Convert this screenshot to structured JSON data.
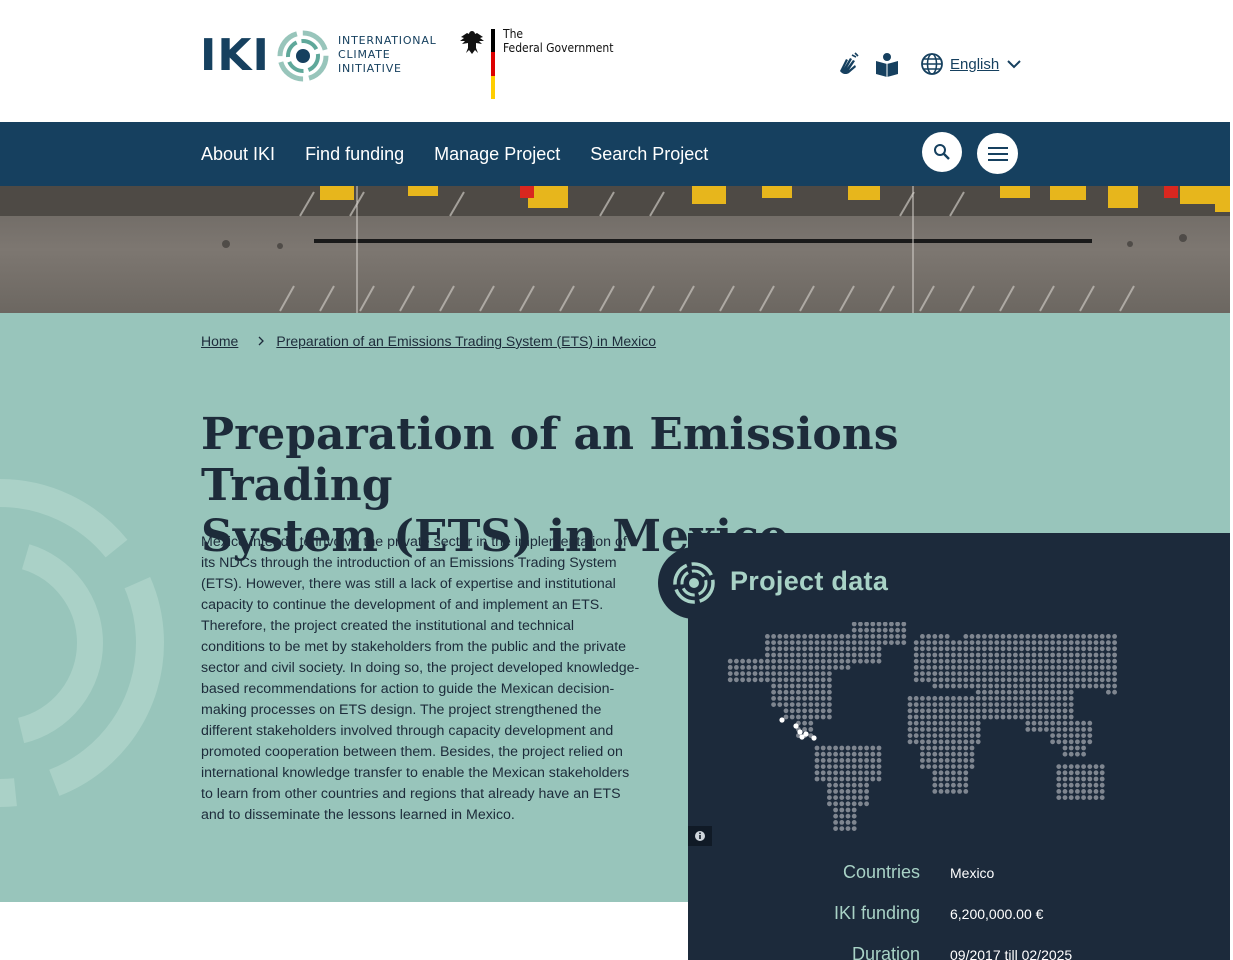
{
  "header": {
    "logo_letters": "IKI",
    "logo_words": [
      "INTERNATIONAL",
      "CLIMATE",
      "INITIATIVE"
    ],
    "gov_text_line1": "The",
    "gov_text_line2": "Federal Government",
    "language_label": "English",
    "icons": [
      "sign-language-icon",
      "easy-read-icon",
      "globe-icon",
      "chevron-down-icon"
    ]
  },
  "nav": {
    "items": [
      {
        "label": "About IKI"
      },
      {
        "label": "Find funding"
      },
      {
        "label": "Manage Project"
      },
      {
        "label": "Search Project"
      }
    ],
    "icons": [
      "search-icon",
      "hamburger-menu-icon"
    ]
  },
  "breadcrumb": {
    "home": "Home",
    "current": "Preparation of an Emissions Trading System (ETS) in Mexico"
  },
  "page": {
    "title_line1": "Preparation of an Emissions Trading",
    "title_line2": "System (ETS) in Mexico",
    "description": "Mexico intends to involve the private sector in the implementation of its NDCs through the introduction of an Emissions Trading System (ETS). However, there was still a lack of expertise and institutional capacity to continue the development of and implement an ETS. Therefore, the project created the institutional and technical conditions to be met by stakeholders from the public and the private sector and civil society. In doing so, the project developed knowledge-based recommendations for action to guide the Mexican decision-making processes on ETS design. The project strengthened the different stakeholders involved through capacity development and promoted cooperation between them. Besides, the project relied on international knowledge transfer to enable the Mexican stakeholders to learn from other countries and regions that already have an ETS and to disseminate the lessons learned in Mexico."
  },
  "project_data": {
    "title": "Project data",
    "rows": [
      {
        "label": "Countries",
        "value": "Mexico"
      },
      {
        "label": "IKI funding",
        "value": "6,200,000.00 €"
      },
      {
        "label": "Duration",
        "value": "09/2017 till 02/2025"
      }
    ]
  },
  "colors": {
    "navy": "#16405f",
    "mint": "#98c5bb",
    "panel": "#1c2a3b",
    "panel_accent": "#a8d2c6"
  }
}
